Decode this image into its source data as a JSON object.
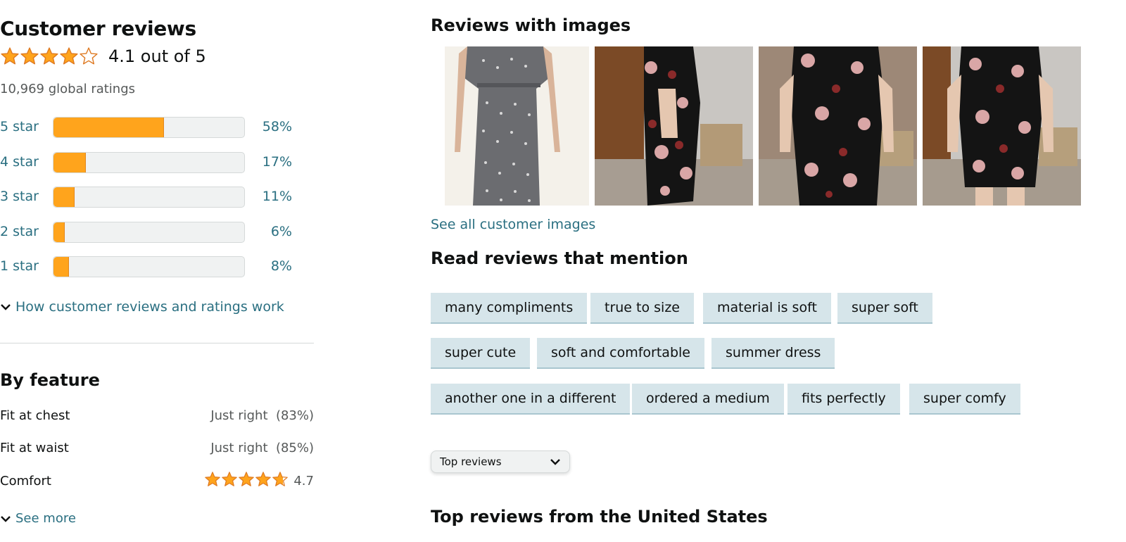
{
  "reviews": {
    "title": "Customer reviews",
    "average_rating": 4.1,
    "rating_text": "4.1 out of 5",
    "global_ratings": "10,969 global ratings",
    "histogram": [
      {
        "label": "5 star",
        "percent_text": "58%",
        "percent": 58
      },
      {
        "label": "4 star",
        "percent_text": "17%",
        "percent": 17
      },
      {
        "label": "3 star",
        "percent_text": "11%",
        "percent": 11
      },
      {
        "label": "2 star",
        "percent_text": "6%",
        "percent": 6
      },
      {
        "label": "1 star",
        "percent_text": "8%",
        "percent": 8
      }
    ],
    "how_link": "How customer reviews and ratings work",
    "star_color": "#ffa41c"
  },
  "features": {
    "title": "By feature",
    "items": [
      {
        "name": "Fit at chest",
        "value": "Just right  (83%)"
      },
      {
        "name": "Fit at waist",
        "value": "Just right  (85%)"
      },
      {
        "name": "Comfort",
        "rating": 4.7,
        "value": "4.7"
      }
    ],
    "see_more": "See more"
  },
  "images_section": {
    "title": "Reviews with images",
    "images": [
      "gray-polka-dot-dress-photo",
      "black-floral-dress-photo-1",
      "black-floral-dress-photo-2",
      "black-floral-dress-photo-3"
    ],
    "see_all": "See all customer images"
  },
  "mentions": {
    "title": "Read reviews that mention",
    "chips": [
      [
        "many compliments",
        "true to size",
        "material is soft",
        "super soft"
      ],
      [
        "super cute",
        "soft and comfortable",
        "summer dress"
      ],
      [
        "another one in a different",
        "ordered a medium",
        "fits perfectly",
        "super comfy"
      ]
    ]
  },
  "sort": {
    "selected": "Top reviews"
  },
  "top_reviews": {
    "title": "Top reviews from the United States"
  },
  "colors": {
    "link": "#2a6f81",
    "bar_fill": "#ffa41c",
    "chip_bg": "#d6e5ea"
  }
}
